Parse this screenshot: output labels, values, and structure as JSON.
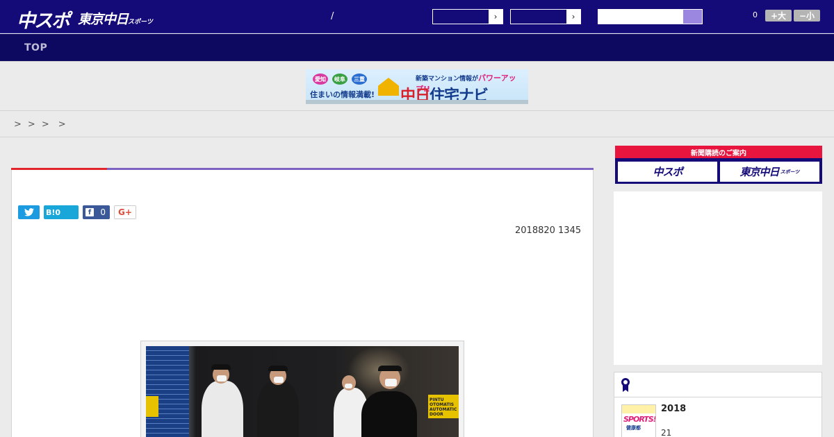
{
  "header": {
    "logo_main": "中スポ",
    "logo_sub": "東京中日",
    "logo_sub_small": "スポーツ",
    "slash": "/",
    "select_arrow": "›",
    "search_placeholder": "",
    "count": "0",
    "size_up": "+大",
    "size_down": "−小"
  },
  "nav": {
    "top": "TOP"
  },
  "banner": {
    "bubbles": [
      "愛知",
      "岐阜",
      "三重"
    ],
    "tagline": "住まいの情報満載!",
    "headline": "新築マンション情報が",
    "headline_em": "パワーアップ!!",
    "brand_a": "中日",
    "brand_b": "住宅ナビ"
  },
  "breadcrumb": [
    ">",
    ">",
    ">",
    ">"
  ],
  "article": {
    "share_twitter_count": "",
    "share_hatena": "B!0",
    "share_fb_count": "0",
    "share_gplus": "G+",
    "pub_date": "2018820 1345",
    "photo_sign": "PINTU OTOMATIS AUTOMATIC DOOR"
  },
  "sidebar": {
    "paper_title": "新聞購読のご案内",
    "paper_btn_1": "中スポ",
    "paper_btn_2": "東京中日",
    "paper_btn_2_small": "スポーツ",
    "ranking": {
      "thumb_text": "SPORTS!!",
      "thumb_sub": "健康都",
      "item_title": "2018",
      "item_num": "21"
    }
  },
  "colors": {
    "header_bg": "#140a78",
    "nav_bg": "#0d0860",
    "accent_red": "#e0262b",
    "accent_purple": "#7d62c2",
    "twitter": "#1c9be0",
    "facebook": "#3b5998"
  }
}
